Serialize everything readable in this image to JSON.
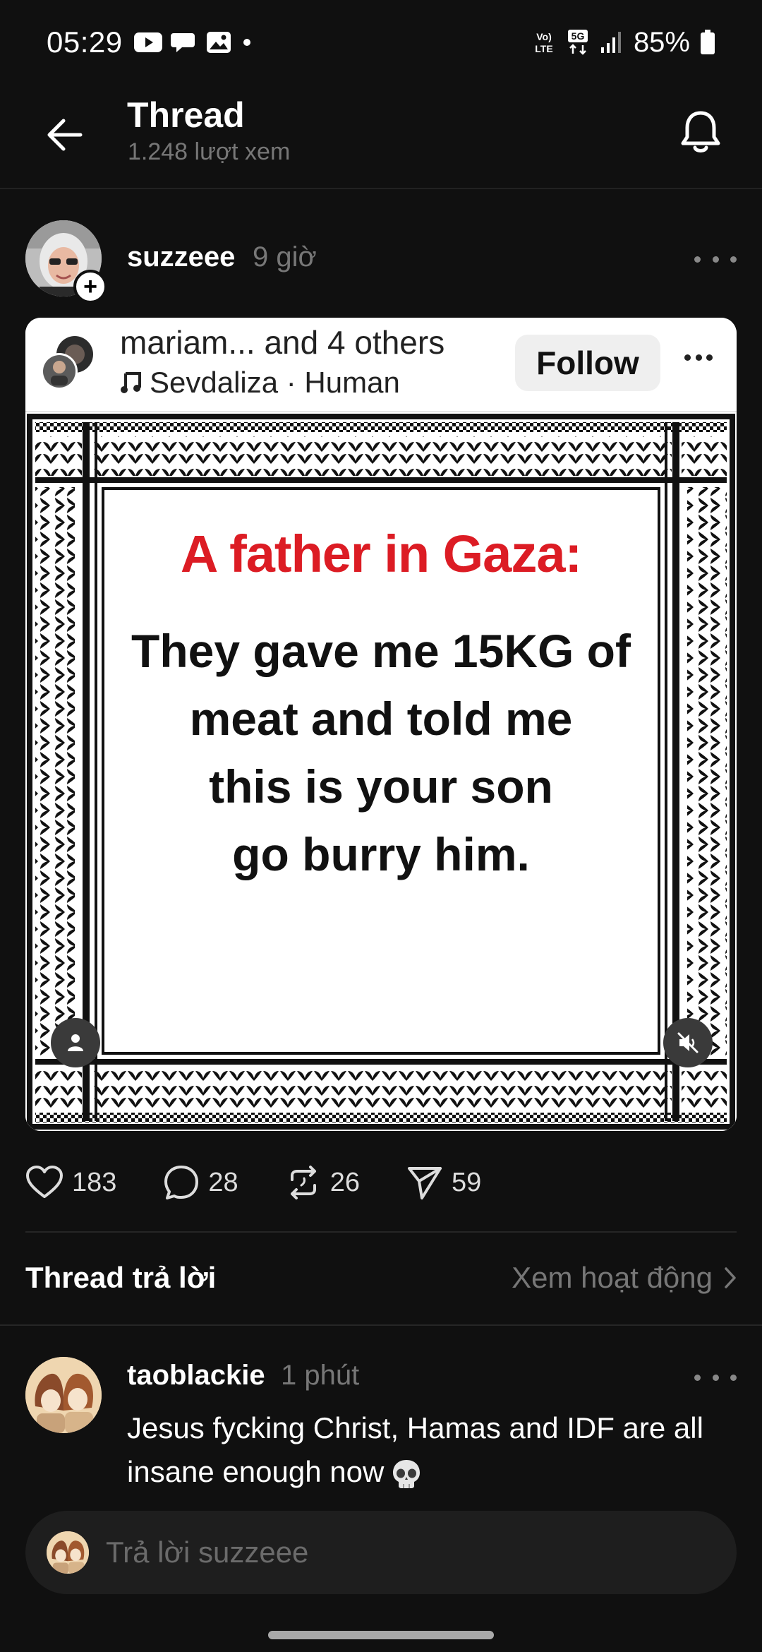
{
  "status_bar": {
    "time": "05:29",
    "battery": "85%",
    "network": "5G",
    "volte": "VoLTE"
  },
  "header": {
    "title": "Thread",
    "views": "1.248 lượt xem"
  },
  "post": {
    "username": "suzzeee",
    "time": "9 giờ",
    "embed": {
      "names": "mariam... and 4 others",
      "song": "Sevdaliza · Human",
      "follow_label": "Follow",
      "headline": "A father in Gaza:",
      "quote_lines": [
        "They gave me 15KG of",
        "meat and told me",
        "this is your son",
        "go burry him."
      ]
    },
    "stats": {
      "likes": "183",
      "comments": "28",
      "reposts": "26",
      "shares": "59"
    }
  },
  "replies_section": {
    "title": "Thread trả lời",
    "view_activity": "Xem hoạt động"
  },
  "reply": {
    "username": "taoblackie",
    "time": "1 phút",
    "text": "Jesus fycking Christ, Hamas and IDF are all insane enough now"
  },
  "reply_input": {
    "placeholder": "Trả lời suzzeee"
  },
  "colors": {
    "background": "#101010",
    "headline_red": "#dc1c24",
    "muted_text": "#777777"
  }
}
